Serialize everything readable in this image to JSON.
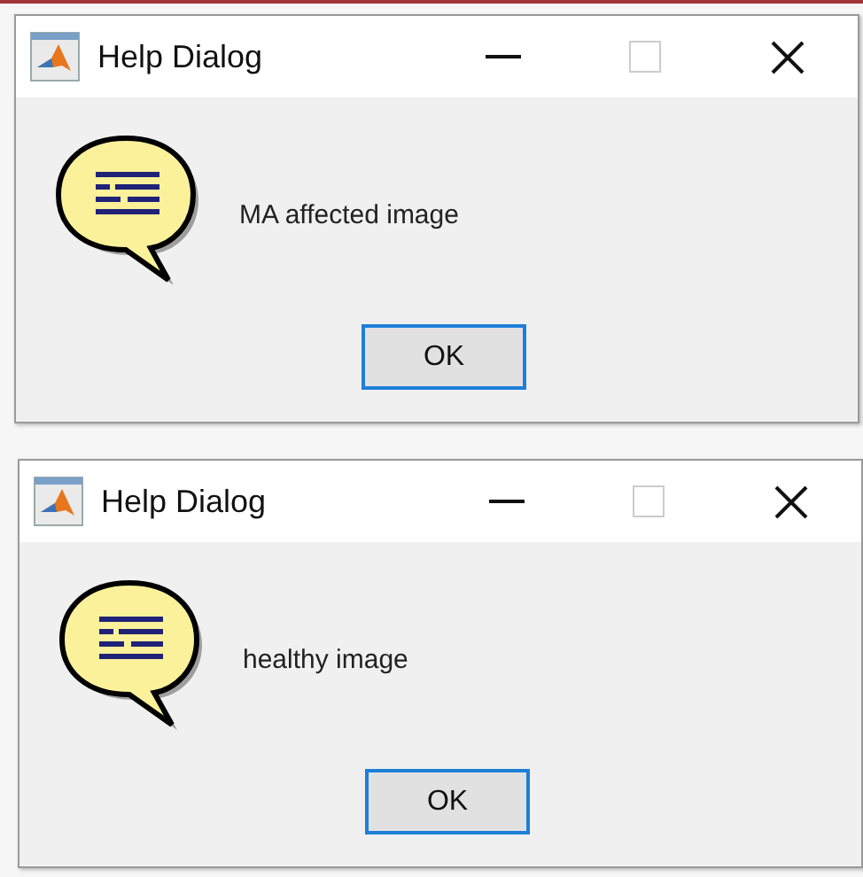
{
  "dialogs": [
    {
      "title": "Help Dialog",
      "message": "MA affected image",
      "buttons": [
        {
          "label": "OK",
          "focused": true
        }
      ]
    },
    {
      "title": "Help Dialog",
      "message": "healthy image",
      "buttons": [
        {
          "label": "OK",
          "focused": true
        }
      ]
    }
  ]
}
